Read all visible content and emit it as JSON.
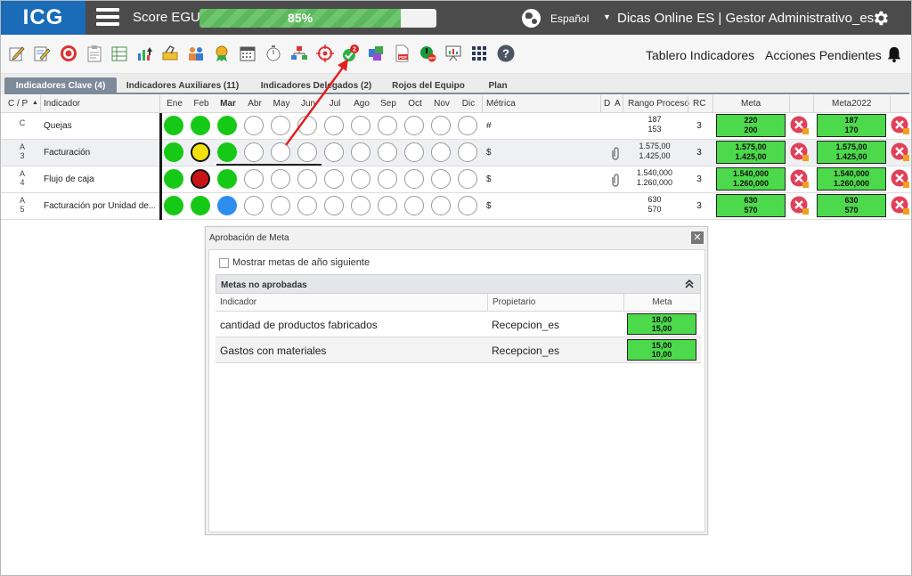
{
  "header": {
    "logo": "ICG",
    "score_label": "Score EGU:",
    "score_value": "85%",
    "score_fraction": 0.85,
    "language": "Español",
    "user": "Dicas Online ES  |  Gestor Administrativo_es"
  },
  "toolbar": {
    "icons": [
      "edit-icon",
      "edit-list-icon",
      "target-icon",
      "clipboard-icon",
      "list-icon",
      "chart-icon",
      "clip-tool-icon",
      "team-icon",
      "award-icon",
      "calendar-icon",
      "timer-icon",
      "hierarchy-icon",
      "crosshair-icon",
      "approval-icon",
      "puzzle-icon",
      "pdf-icon",
      "off-icon",
      "presentation-icon",
      "grid-icon",
      "help-icon"
    ],
    "approval_badge": "2",
    "tablero_link": "Tablero Indicadores",
    "acciones_link": "Acciones Pendientes"
  },
  "tabs": [
    {
      "label": "Indicadores Clave (4)",
      "active": true
    },
    {
      "label": "Indicadores Auxiliares (11)",
      "active": false
    },
    {
      "label": "Indicadores Delegados (2)",
      "active": false
    },
    {
      "label": "Rojos del Equipo",
      "active": false
    },
    {
      "label": "Plan",
      "active": false
    }
  ],
  "grid": {
    "headers": {
      "cp": "C / P",
      "indicador": "Indicador",
      "months": [
        "Ene",
        "Feb",
        "Mar",
        "Abr",
        "May",
        "Jun",
        "Jul",
        "Ago",
        "Sep",
        "Oct",
        "Nov",
        "Dic"
      ],
      "metrica": "Métrica",
      "d": "D",
      "a": "A",
      "rango": "Rango Proceso",
      "rc": "RC",
      "meta": "Meta",
      "meta2022": "Meta2022"
    },
    "rows": [
      {
        "cp1": "C",
        "cp2": "",
        "name": "Quejas",
        "metric": "#",
        "range_hi": "187",
        "range_lo": "153",
        "rc": "3",
        "meta_hi": "220",
        "meta_lo": "200",
        "meta2022_hi": "187",
        "meta2022_lo": "170",
        "clip": false,
        "months": [
          "green",
          "green",
          "green",
          "empty",
          "empty",
          "empty",
          "empty",
          "empty",
          "empty",
          "empty",
          "empty",
          "empty"
        ]
      },
      {
        "cp1": "A",
        "cp2": "3",
        "name": "Facturación",
        "metric": "$",
        "range_hi": "1.575,00",
        "range_lo": "1.425,00",
        "rc": "3",
        "meta_hi": "1.575,00",
        "meta_lo": "1.425,00",
        "meta2022_hi": "1.575,00",
        "meta2022_lo": "1.425,00",
        "clip": true,
        "months": [
          "green",
          "yellow",
          "green",
          "empty",
          "empty",
          "empty",
          "empty",
          "empty",
          "empty",
          "empty",
          "empty",
          "empty"
        ]
      },
      {
        "cp1": "A",
        "cp2": "4",
        "name": "Flujo de caja",
        "metric": "$",
        "range_hi": "1.540,000",
        "range_lo": "1.260,000",
        "rc": "3",
        "meta_hi": "1.540,000",
        "meta_lo": "1.260,000",
        "meta2022_hi": "1.540,000",
        "meta2022_lo": "1.260,000",
        "clip": true,
        "months": [
          "green",
          "red",
          "green",
          "empty",
          "empty",
          "empty",
          "empty",
          "empty",
          "empty",
          "empty",
          "empty",
          "empty"
        ]
      },
      {
        "cp1": "A",
        "cp2": "5",
        "name": "Facturación por Unidad de...",
        "metric": "$",
        "range_hi": "630",
        "range_lo": "570",
        "rc": "3",
        "meta_hi": "630",
        "meta_lo": "570",
        "meta2022_hi": "630",
        "meta2022_lo": "570",
        "clip": false,
        "months": [
          "green",
          "green",
          "blue",
          "empty",
          "empty",
          "empty",
          "empty",
          "empty",
          "empty",
          "empty",
          "empty",
          "empty"
        ]
      }
    ]
  },
  "colors": {
    "green": "#17c917",
    "yellow": "#f5e10f",
    "red": "#c81414",
    "blue": "#2e8ef0",
    "empty": "#ffffff",
    "accent": "#1a6bb8",
    "goal_green": "#4cd94c"
  },
  "dialog": {
    "title": "Aprobación de Meta",
    "close": "✕",
    "checkbox_label": "Mostrar metas de año siguiente",
    "panel_title": "Metas no aprobadas",
    "columns": [
      "Indicador",
      "Propietario",
      "Meta"
    ],
    "rows": [
      {
        "indicador": "cantidad de productos fabricados",
        "propietario": "Recepcion_es",
        "meta_hi": "18,00",
        "meta_lo": "15,00"
      },
      {
        "indicador": "Gastos con materiales",
        "propietario": "Recepcion_es",
        "meta_hi": "15,00",
        "meta_lo": "10,00"
      }
    ]
  }
}
